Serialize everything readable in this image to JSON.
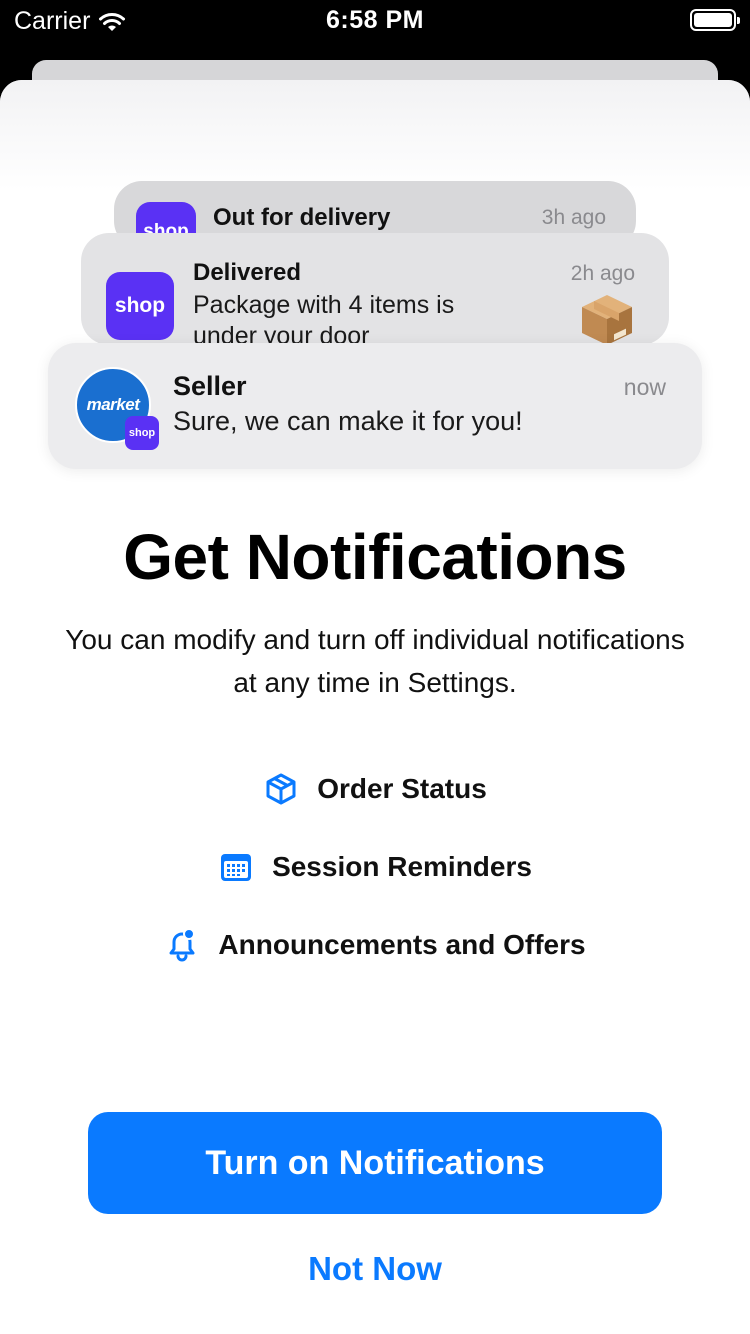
{
  "status_bar": {
    "carrier": "Carrier",
    "time": "6:58 PM",
    "battery_level": 1.0
  },
  "notifications": [
    {
      "app_icon_text": "shop",
      "title": "Out for delivery",
      "time": "3h ago"
    },
    {
      "app_icon_text": "shop",
      "title": "Delivered",
      "time": "2h ago",
      "body": "Package with 4 items is under your door",
      "attachment_icon": "package-icon"
    },
    {
      "avatar_text": "market",
      "badge_text": "shop",
      "title": "Seller",
      "time": "now",
      "body": "Sure, we can make it for you!"
    }
  ],
  "headline": "Get Notifications",
  "subtitle": "You can modify and turn off individual notifications at any time in Settings.",
  "features": [
    {
      "icon": "box-icon",
      "label": "Order Status"
    },
    {
      "icon": "calendar-icon",
      "label": "Session Reminders"
    },
    {
      "icon": "bell-icon",
      "label": "Announcements and Offers"
    }
  ],
  "primary_button": "Turn on Notifications",
  "secondary_button": "Not Now",
  "colors": {
    "accent": "#0a7aff",
    "shop_purple": "#5a31f4",
    "avatar_blue": "#1a6fd0"
  }
}
